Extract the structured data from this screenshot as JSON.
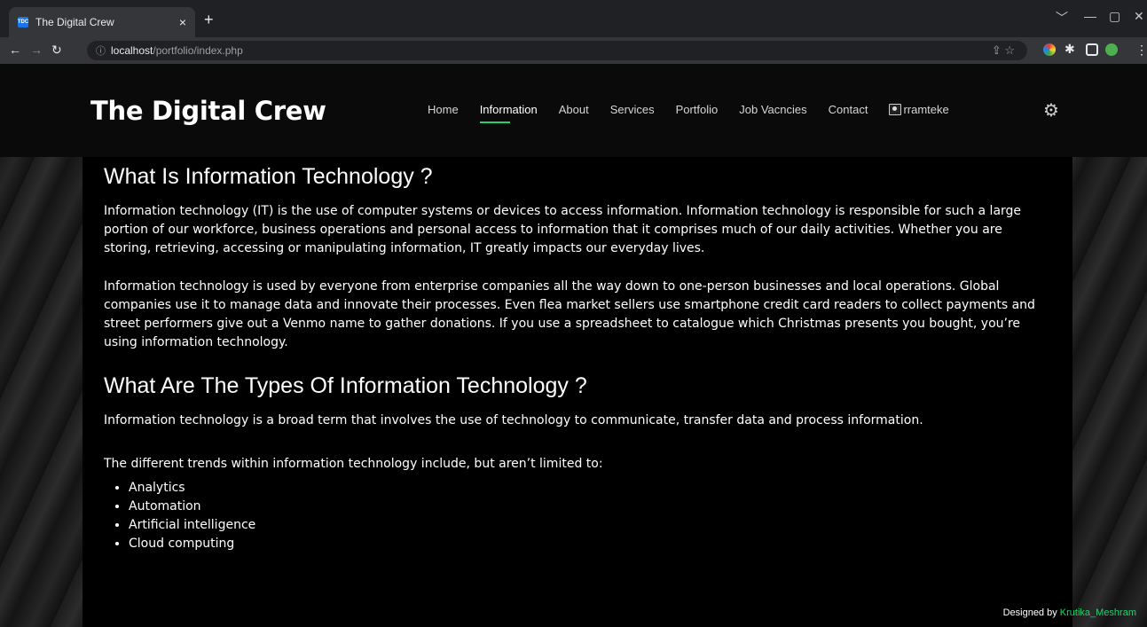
{
  "browser": {
    "tab_title": "The Digital Crew",
    "tab_close": "×",
    "new_tab": "+",
    "url_host": "localhost",
    "url_path": "/portfolio/index.php",
    "minimize": "﹀",
    "restore": "—",
    "maximize": "▢",
    "close": "✕"
  },
  "site": {
    "logo": "The Digital Crew",
    "nav": [
      "Home",
      "Information",
      "About",
      "Services",
      "Portfolio",
      "Job Vacncies",
      "Contact"
    ],
    "active_nav": "Information",
    "user": "rramteke"
  },
  "content": {
    "heading1": "What Is Information Technology ?",
    "para1": "Information technology (IT) is the use of computer systems or devices to access information. Information technology is responsible for such a large portion of our workforce, business operations and personal access to information that it comprises much of our daily activities. Whether you are storing, retrieving, accessing or manipulating information, IT greatly impacts our everyday lives.",
    "para2": "Information technology is used by everyone from enterprise companies all the way down to one-person businesses and local operations. Global companies use it to manage data and innovate their processes. Even flea market sellers use smartphone credit card readers to collect payments and street performers give out a Venmo name to gather donations. If you use a spreadsheet to catalogue which Christmas presents you bought, you’re using information technology.",
    "heading2": "What Are The Types Of Information Technology ?",
    "para3": "Information technology is a broad term that involves the use of technology to communicate, transfer data and process information.",
    "para4": "The different trends within information technology include, but aren’t limited to:",
    "list": [
      "Analytics",
      "Automation",
      "Artificial intelligence",
      "Cloud computing"
    ]
  },
  "footer": {
    "designed_by": "Designed by ",
    "author": "Krutika_Meshram"
  }
}
